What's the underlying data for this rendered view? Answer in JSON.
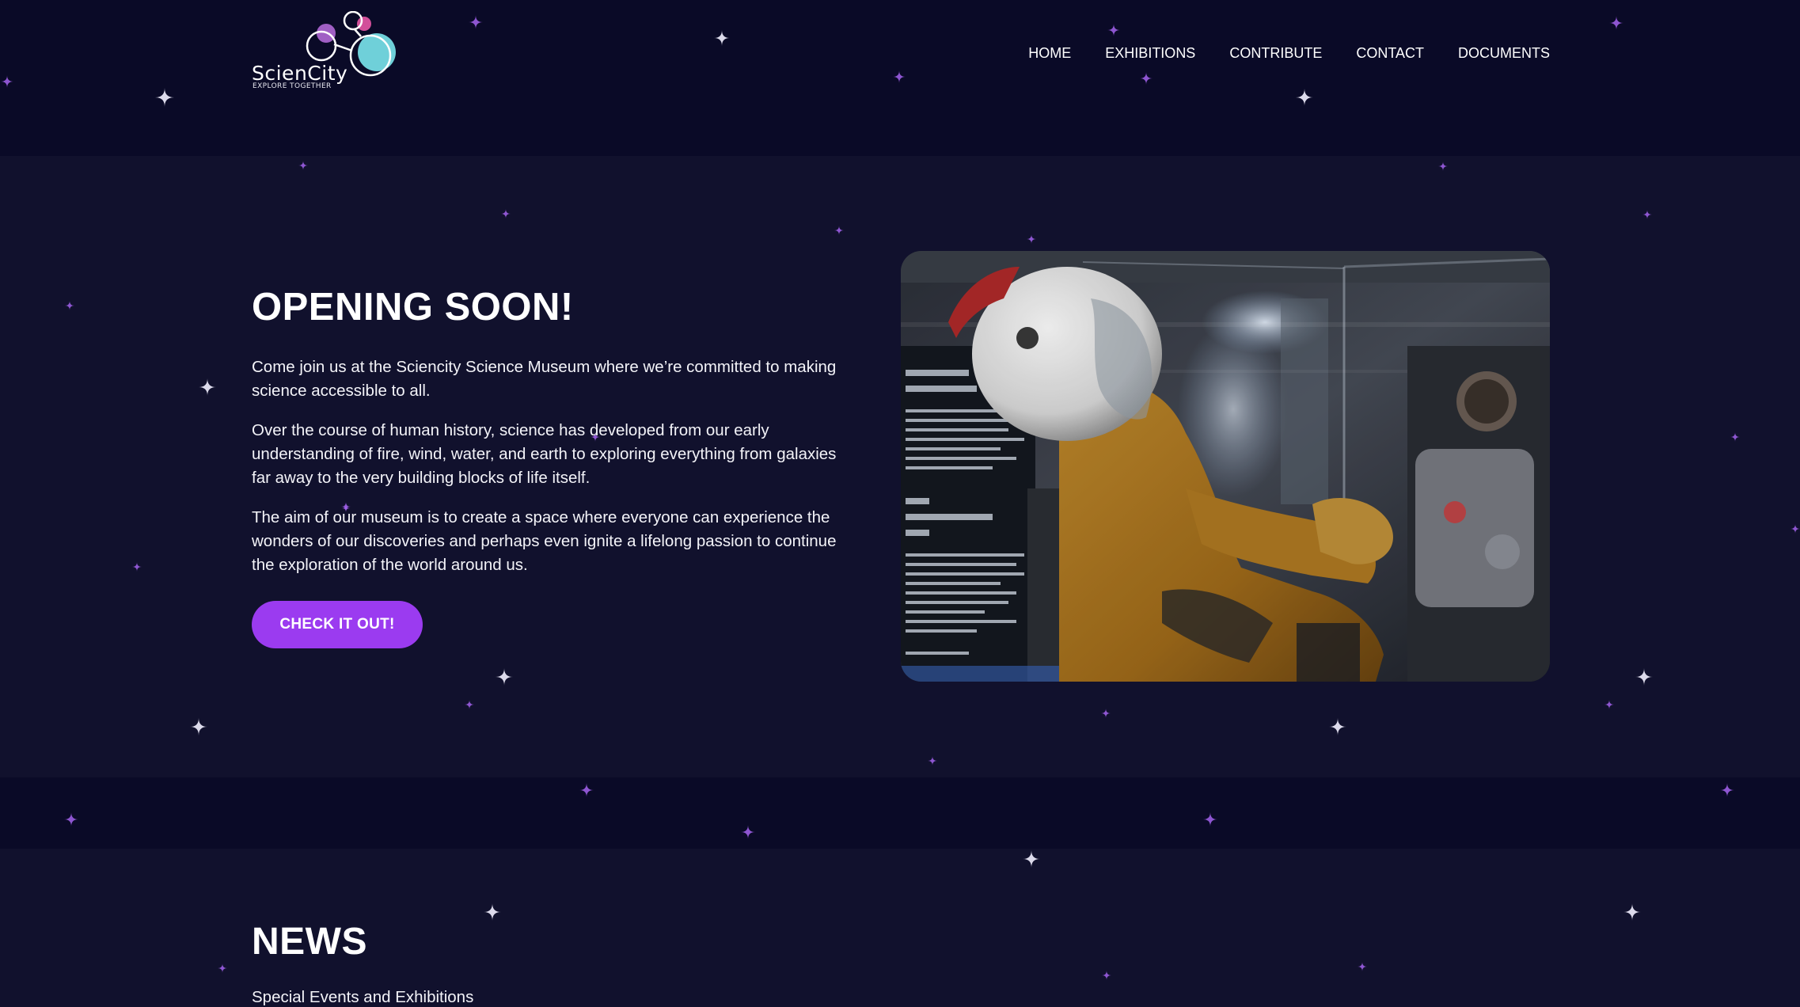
{
  "logo": {
    "name": "ScienCity",
    "tagline": "EXPLORE TOGETHER"
  },
  "nav": {
    "items": [
      {
        "label": "HOME"
      },
      {
        "label": "EXHIBITIONS"
      },
      {
        "label": "CONTRIBUTE"
      },
      {
        "label": "CONTACT"
      },
      {
        "label": "DOCUMENTS"
      }
    ]
  },
  "hero": {
    "title": "OPENING SOON!",
    "paragraphs": [
      "Come join us at the Sciencity Science Museum where we’re committed to making science accessible to all.",
      "Over the course of human history, science has developed from our early understanding of fire, wind, water, and earth to exploring everything from galaxies far away to the very building blocks of life itself.",
      "The aim of our museum is to create a space where everyone can experience the wonders of our discoveries and perhaps even ignite a lifelong passion to continue the exploration of the world around us."
    ],
    "cta_label": "CHECK IT OUT!",
    "image_alt": "Astronaut in a flight suit inside an exhibit display case"
  },
  "news": {
    "title": "NEWS",
    "subtitle": "Special Events and Exhibitions"
  },
  "colors": {
    "background": "#11112d",
    "band_dark": "#0a0a27",
    "accent": "#9b3bf0",
    "logo_teal": "#6fd0d9",
    "logo_pink": "#d24f9a",
    "star_purple": "#a463ee"
  }
}
